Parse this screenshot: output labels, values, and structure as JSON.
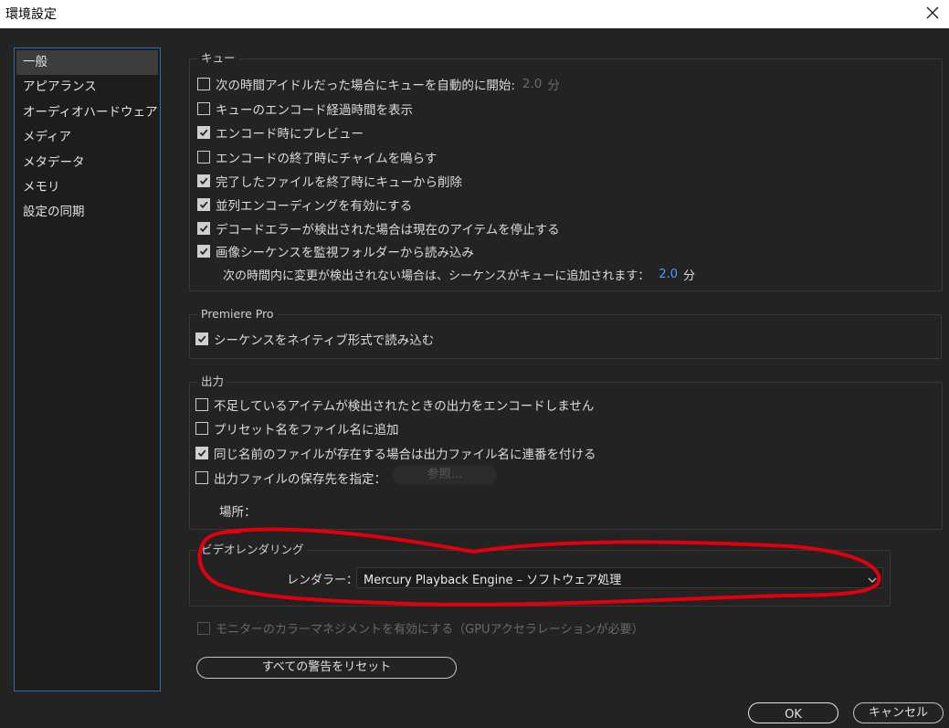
{
  "window": {
    "title": "環境設定",
    "close_label": "×"
  },
  "sidebar": {
    "items": [
      {
        "label": "一般",
        "selected": true
      },
      {
        "label": "アピアランス"
      },
      {
        "label": "オーディオハードウェア"
      },
      {
        "label": "メディア"
      },
      {
        "label": "メタデータ"
      },
      {
        "label": "メモリ"
      },
      {
        "label": "設定の同期"
      }
    ]
  },
  "queue": {
    "title": "キュー",
    "items": [
      {
        "label": "次の時間アイドルだった場合にキューを自動的に開始:",
        "checked": false,
        "value": "2.0",
        "unit": "分"
      },
      {
        "label": "キューのエンコード経過時間を表示",
        "checked": false
      },
      {
        "label": "エンコード時にプレビュー",
        "checked": true
      },
      {
        "label": "エンコードの終了時にチャイムを鳴らす",
        "checked": false
      },
      {
        "label": "完了したファイルを終了時にキューから削除",
        "checked": true
      },
      {
        "label": "並列エンコーディングを有効にする",
        "checked": true
      },
      {
        "label": "デコードエラーが検出された場合は現在のアイテムを停止する",
        "checked": true
      },
      {
        "label": "画像シーケンスを監視フォルダーから読み込み",
        "checked": true
      }
    ],
    "sequence_note": "次の時間内に変更が検出されない場合は、シーケンスがキューに追加されます：",
    "sequence_value": "2.0",
    "sequence_unit": "分"
  },
  "premiere": {
    "title": "Premiere Pro",
    "items": [
      {
        "label": "シーケンスをネイティブ形式で読み込む",
        "checked": true
      }
    ]
  },
  "output": {
    "title": "出力",
    "items": [
      {
        "label": "不足しているアイテムが検出されたときの出力をエンコードしません",
        "checked": false
      },
      {
        "label": "プリセット名をファイル名に追加",
        "checked": false
      },
      {
        "label": "同じ名前のファイルが存在する場合は出力ファイル名に連番を付ける",
        "checked": true
      },
      {
        "label": "出力ファイルの保存先を指定：",
        "checked": false
      }
    ],
    "browse_label": "参照...",
    "location_label": "場所："
  },
  "video_rendering": {
    "title": "ビデオレンダリング",
    "renderer_label": "レンダラー：",
    "renderer_value": "Mercury Playback Engine – ソフトウェア処理"
  },
  "color_management": {
    "label": "モニターのカラーマネジメントを有効にする（GPUアクセラレーションが必要）",
    "checked": false,
    "disabled": true
  },
  "buttons": {
    "reset_warnings": "すべての警告をリセット",
    "ok": "OK",
    "cancel": "キャンセル"
  },
  "colors": {
    "background": "#232323",
    "title_bar": "#ffffff",
    "accent_blue": "#4b9dfa",
    "sidebar_border": "#2e6fb0",
    "annotation_red": "#e0000f"
  },
  "icons": {
    "close": "close-icon",
    "chevron": "chevron-down-icon",
    "checkmark": "checkmark-icon"
  }
}
